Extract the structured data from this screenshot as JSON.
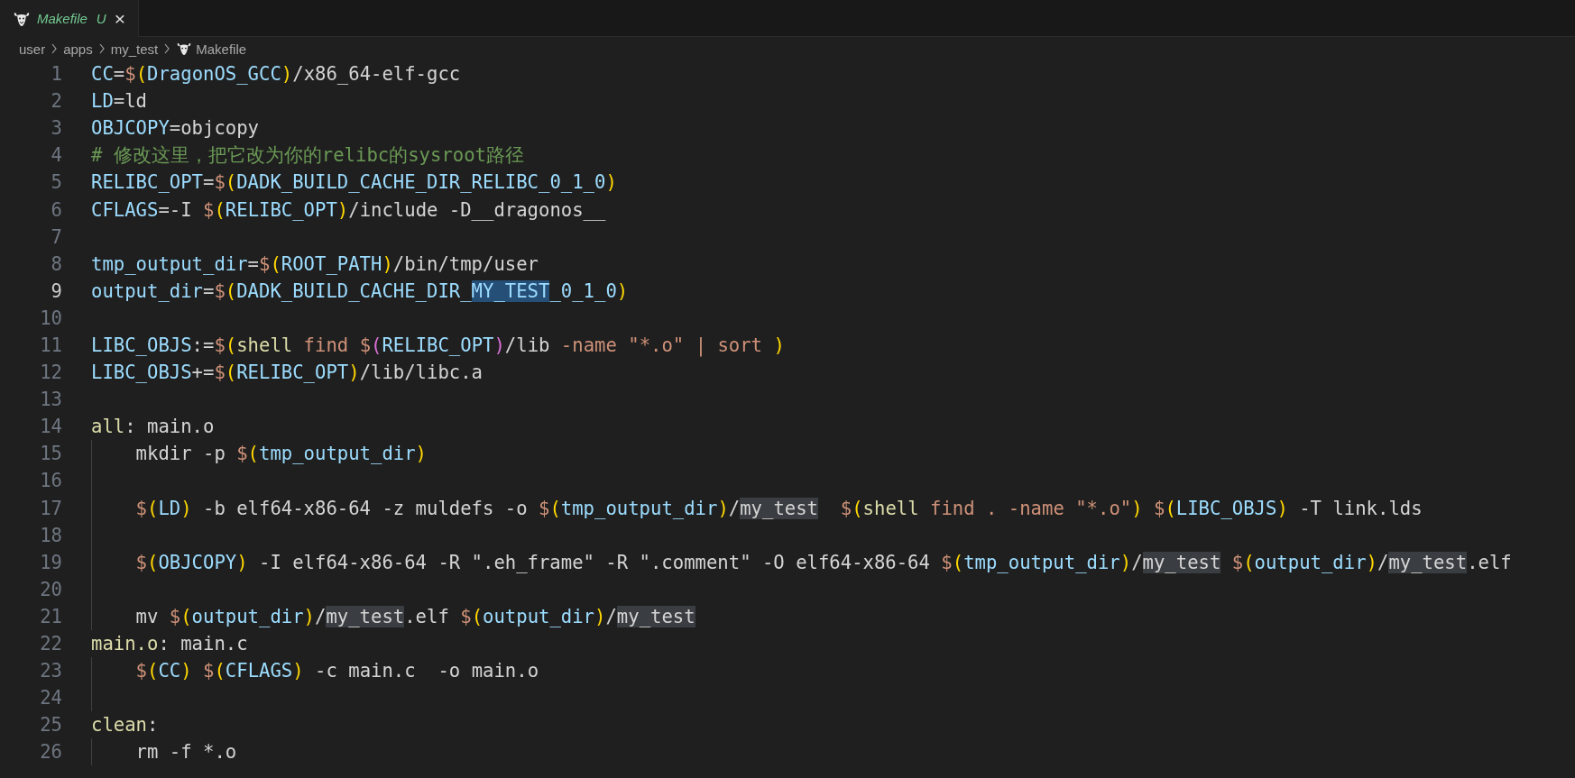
{
  "tab": {
    "title": "Makefile",
    "status": "U",
    "close": "×",
    "selected": true,
    "preview": true
  },
  "breadcrumbs": [
    "user",
    "apps",
    "my_test",
    "Makefile"
  ],
  "lines": [
    {
      "number": "1",
      "current": false,
      "indented": false,
      "tokens": [
        {
          "kind": "v",
          "text": "CC"
        },
        {
          "kind": "t",
          "text": "="
        },
        {
          "kind": "d",
          "text": "$"
        },
        {
          "kind": "p",
          "text": "("
        },
        {
          "kind": "v",
          "text": "DragonOS_GCC"
        },
        {
          "kind": "p",
          "text": ")"
        },
        {
          "kind": "t",
          "text": "/x86_64-elf-gcc"
        }
      ]
    },
    {
      "number": "2",
      "current": false,
      "indented": false,
      "tokens": [
        {
          "kind": "v",
          "text": "LD"
        },
        {
          "kind": "t",
          "text": "=ld"
        }
      ]
    },
    {
      "number": "3",
      "current": false,
      "indented": false,
      "tokens": [
        {
          "kind": "v",
          "text": "OBJCOPY"
        },
        {
          "kind": "t",
          "text": "=objcopy"
        }
      ]
    },
    {
      "number": "4",
      "current": false,
      "indented": false,
      "tokens": [
        {
          "kind": "c",
          "text": "# 修改这里，把它改为你的relibc的sysroot路径"
        }
      ]
    },
    {
      "number": "5",
      "current": false,
      "indented": false,
      "tokens": [
        {
          "kind": "v",
          "text": "RELIBC_OPT"
        },
        {
          "kind": "t",
          "text": "="
        },
        {
          "kind": "d",
          "text": "$"
        },
        {
          "kind": "p",
          "text": "("
        },
        {
          "kind": "v",
          "text": "DADK_BUILD_CACHE_DIR_RELIBC_0_1_0"
        },
        {
          "kind": "p",
          "text": ")"
        }
      ]
    },
    {
      "number": "6",
      "current": false,
      "indented": false,
      "tokens": [
        {
          "kind": "v",
          "text": "CFLAGS"
        },
        {
          "kind": "t",
          "text": "=-I "
        },
        {
          "kind": "d",
          "text": "$"
        },
        {
          "kind": "p",
          "text": "("
        },
        {
          "kind": "v",
          "text": "RELIBC_OPT"
        },
        {
          "kind": "p",
          "text": ")"
        },
        {
          "kind": "t",
          "text": "/include -D__dragonos__"
        }
      ]
    },
    {
      "number": "7",
      "current": false,
      "indented": false
    },
    {
      "number": "8",
      "current": false,
      "indented": false,
      "tokens": [
        {
          "kind": "v",
          "text": "tmp_output_dir"
        },
        {
          "kind": "t",
          "text": "="
        },
        {
          "kind": "d",
          "text": "$"
        },
        {
          "kind": "p",
          "text": "("
        },
        {
          "kind": "v",
          "text": "ROOT_PATH"
        },
        {
          "kind": "p",
          "text": ")"
        },
        {
          "kind": "t",
          "text": "/bin/tmp/user"
        }
      ]
    },
    {
      "number": "9",
      "current": true,
      "indented": false,
      "tokens": [
        {
          "kind": "v",
          "text": "output_dir"
        },
        {
          "kind": "t",
          "text": "="
        },
        {
          "kind": "d",
          "text": "$"
        },
        {
          "kind": "p",
          "text": "("
        },
        {
          "kind": "v",
          "text": "DADK_BUILD_CACHE_DIR_"
        },
        {
          "kind": "sel",
          "text": "MY_TEST"
        },
        {
          "kind": "v",
          "text": "_0_1_0"
        },
        {
          "kind": "p",
          "text": ")"
        }
      ]
    },
    {
      "number": "10",
      "current": false,
      "indented": false
    },
    {
      "number": "11",
      "current": false,
      "indented": false,
      "tokens": [
        {
          "kind": "v",
          "text": "LIBC_OBJS"
        },
        {
          "kind": "t",
          "text": ":="
        },
        {
          "kind": "d",
          "text": "$"
        },
        {
          "kind": "p",
          "text": "("
        },
        {
          "kind": "f",
          "text": "shell"
        },
        {
          "kind": "s",
          "text": " find "
        },
        {
          "kind": "d",
          "text": "$"
        },
        {
          "kind": "q",
          "text": "("
        },
        {
          "kind": "v",
          "text": "RELIBC_OPT"
        },
        {
          "kind": "q",
          "text": ")"
        },
        {
          "kind": "t",
          "text": "/lib "
        },
        {
          "kind": "s",
          "text": "-name \"*.o\" | sort "
        },
        {
          "kind": "p",
          "text": ")"
        }
      ]
    },
    {
      "number": "12",
      "current": false,
      "indented": false,
      "tokens": [
        {
          "kind": "v",
          "text": "LIBC_OBJS"
        },
        {
          "kind": "t",
          "text": "+="
        },
        {
          "kind": "d",
          "text": "$"
        },
        {
          "kind": "p",
          "text": "("
        },
        {
          "kind": "v",
          "text": "RELIBC_OPT"
        },
        {
          "kind": "p",
          "text": ")"
        },
        {
          "kind": "t",
          "text": "/lib/libc.a"
        }
      ]
    },
    {
      "number": "13",
      "current": false,
      "indented": false
    },
    {
      "number": "14",
      "current": false,
      "indented": false,
      "tokens": [
        {
          "kind": "f",
          "text": "all"
        },
        {
          "kind": "t",
          "text": ": main.o"
        }
      ]
    },
    {
      "number": "15",
      "current": false,
      "indented": true,
      "tokens": [
        {
          "kind": "t",
          "text": "mkdir -p "
        },
        {
          "kind": "d",
          "text": "$"
        },
        {
          "kind": "p",
          "text": "("
        },
        {
          "kind": "v",
          "text": "tmp_output_dir"
        },
        {
          "kind": "p",
          "text": ")"
        }
      ]
    },
    {
      "number": "16",
      "current": false,
      "indented": true
    },
    {
      "number": "17",
      "current": false,
      "indented": true,
      "tokens": [
        {
          "kind": "d",
          "text": "$"
        },
        {
          "kind": "p",
          "text": "("
        },
        {
          "kind": "v",
          "text": "LD"
        },
        {
          "kind": "p",
          "text": ")"
        },
        {
          "kind": "t",
          "text": " -b elf64-x86-64 -z muldefs -o "
        },
        {
          "kind": "d",
          "text": "$"
        },
        {
          "kind": "p",
          "text": "("
        },
        {
          "kind": "v",
          "text": "tmp_output_dir"
        },
        {
          "kind": "p",
          "text": ")"
        },
        {
          "kind": "t",
          "text": "/"
        },
        {
          "kind": "occ",
          "text": "my_test"
        },
        {
          "kind": "d",
          "text": "  $"
        },
        {
          "kind": "p",
          "text": "("
        },
        {
          "kind": "f",
          "text": "shell"
        },
        {
          "kind": "s",
          "text": " find . -name \"*.o\""
        },
        {
          "kind": "p",
          "text": ")"
        },
        {
          "kind": "d",
          "text": " $"
        },
        {
          "kind": "p",
          "text": "("
        },
        {
          "kind": "v",
          "text": "LIBC_OBJS"
        },
        {
          "kind": "p",
          "text": ")"
        },
        {
          "kind": "t",
          "text": " -T link.lds"
        }
      ]
    },
    {
      "number": "18",
      "current": false,
      "indented": true
    },
    {
      "number": "19",
      "current": false,
      "indented": true,
      "tokens": [
        {
          "kind": "d",
          "text": "$"
        },
        {
          "kind": "p",
          "text": "("
        },
        {
          "kind": "v",
          "text": "OBJCOPY"
        },
        {
          "kind": "p",
          "text": ")"
        },
        {
          "kind": "t",
          "text": " -I elf64-x86-64 -R \".eh_frame\" -R \".comment\" -O elf64-x86-64 "
        },
        {
          "kind": "d",
          "text": "$"
        },
        {
          "kind": "p",
          "text": "("
        },
        {
          "kind": "v",
          "text": "tmp_output_dir"
        },
        {
          "kind": "p",
          "text": ")"
        },
        {
          "kind": "t",
          "text": "/"
        },
        {
          "kind": "occ",
          "text": "my_test"
        },
        {
          "kind": "d",
          "text": " $"
        },
        {
          "kind": "p",
          "text": "("
        },
        {
          "kind": "v",
          "text": "output_dir"
        },
        {
          "kind": "p",
          "text": ")"
        },
        {
          "kind": "t",
          "text": "/"
        },
        {
          "kind": "occ",
          "text": "my_test"
        },
        {
          "kind": "t",
          "text": ".elf"
        }
      ]
    },
    {
      "number": "20",
      "current": false,
      "indented": true
    },
    {
      "number": "21",
      "current": false,
      "indented": true,
      "tokens": [
        {
          "kind": "t",
          "text": "mv "
        },
        {
          "kind": "d",
          "text": "$"
        },
        {
          "kind": "p",
          "text": "("
        },
        {
          "kind": "v",
          "text": "output_dir"
        },
        {
          "kind": "p",
          "text": ")"
        },
        {
          "kind": "t",
          "text": "/"
        },
        {
          "kind": "occ",
          "text": "my_test"
        },
        {
          "kind": "t",
          "text": ".elf "
        },
        {
          "kind": "d",
          "text": "$"
        },
        {
          "kind": "p",
          "text": "("
        },
        {
          "kind": "v",
          "text": "output_dir"
        },
        {
          "kind": "p",
          "text": ")"
        },
        {
          "kind": "t",
          "text": "/"
        },
        {
          "kind": "occ",
          "text": "my_test"
        }
      ]
    },
    {
      "number": "22",
      "current": false,
      "indented": false,
      "tokens": [
        {
          "kind": "f",
          "text": "main.o"
        },
        {
          "kind": "t",
          "text": ": main.c"
        }
      ]
    },
    {
      "number": "23",
      "current": false,
      "indented": true,
      "tokens": [
        {
          "kind": "d",
          "text": "$"
        },
        {
          "kind": "p",
          "text": "("
        },
        {
          "kind": "v",
          "text": "CC"
        },
        {
          "kind": "p",
          "text": ")"
        },
        {
          "kind": "d",
          "text": " $"
        },
        {
          "kind": "p",
          "text": "("
        },
        {
          "kind": "v",
          "text": "CFLAGS"
        },
        {
          "kind": "p",
          "text": ")"
        },
        {
          "kind": "t",
          "text": " -c main.c  -o main.o"
        }
      ]
    },
    {
      "number": "24",
      "current": false,
      "indented": true
    },
    {
      "number": "25",
      "current": false,
      "indented": false,
      "tokens": [
        {
          "kind": "f",
          "text": "clean"
        },
        {
          "kind": "t",
          "text": ":"
        }
      ]
    },
    {
      "number": "26",
      "current": false,
      "indented": true,
      "tokens": [
        {
          "kind": "t",
          "text": "rm -f *.o"
        }
      ]
    }
  ]
}
